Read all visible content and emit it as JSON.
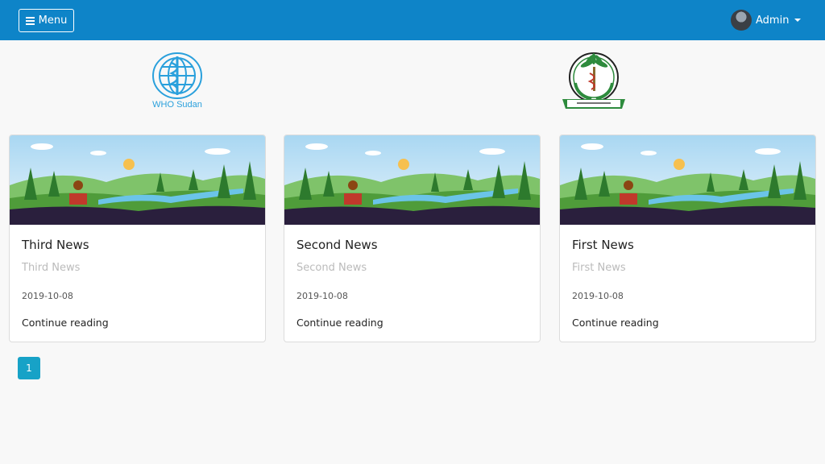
{
  "header": {
    "menu_label": "Menu",
    "user_label": "Admin"
  },
  "logos": {
    "who_text": "WHO Sudan"
  },
  "news": [
    {
      "title": "Third News",
      "subtitle": "Third News",
      "date": "2019-10-08",
      "link": "Continue reading"
    },
    {
      "title": "Second News",
      "subtitle": "Second News",
      "date": "2019-10-08",
      "link": "Continue reading"
    },
    {
      "title": "First News",
      "subtitle": "First News",
      "date": "2019-10-08",
      "link": "Continue reading"
    }
  ],
  "pagination": {
    "current": "1"
  },
  "colors": {
    "header_bg": "#0e84c8",
    "page_active": "#17a2c7",
    "who_blue": "#2aa0dc"
  }
}
